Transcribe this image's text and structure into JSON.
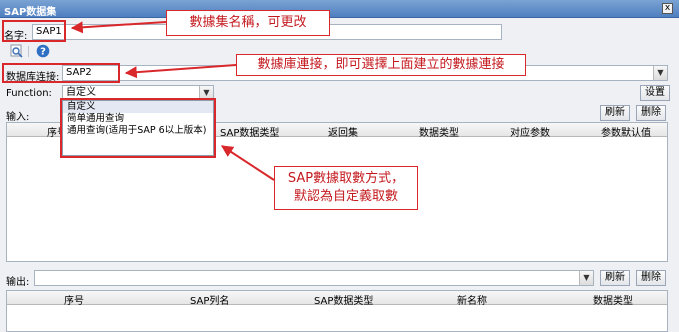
{
  "window": {
    "title": "SAP数据集",
    "close_label": "x"
  },
  "name_row": {
    "label": "名字:",
    "value": "SAP1"
  },
  "toolbar": {
    "preview_icon": "magnifier-icon",
    "help_icon": "help-icon"
  },
  "db_row": {
    "label": "数据库连接:",
    "value": "SAP2"
  },
  "function_row": {
    "label": "Function:",
    "value": "自定义",
    "settings_label": "设置"
  },
  "dropdown": {
    "options": [
      "自定义",
      "简单通用查询",
      "通用查询(适用于SAP 6以上版本)"
    ]
  },
  "input_section": {
    "label": "输入:",
    "refresh_label": "刷新",
    "delete_label": "删除",
    "headers": [
      "序号",
      "SAP数据类型",
      "返回集",
      "数据类型",
      "对应参数",
      "参数默认值"
    ]
  },
  "output_section": {
    "label": "输出:",
    "refresh_label": "刷新",
    "delete_label": "删除",
    "headers": [
      "序号",
      "SAP列名",
      "SAP数据类型",
      "新名称",
      "数据类型"
    ]
  },
  "callouts": {
    "name": "數據集名稱，可更改",
    "db": "數據庫連接，即可選擇上面建立的數據連接",
    "function_line1": "SAP數據取數方式，",
    "function_line2": "默認為自定義取數"
  },
  "colors": {
    "annotation": "#d9282b",
    "titlebar": "#4f7fc0"
  }
}
